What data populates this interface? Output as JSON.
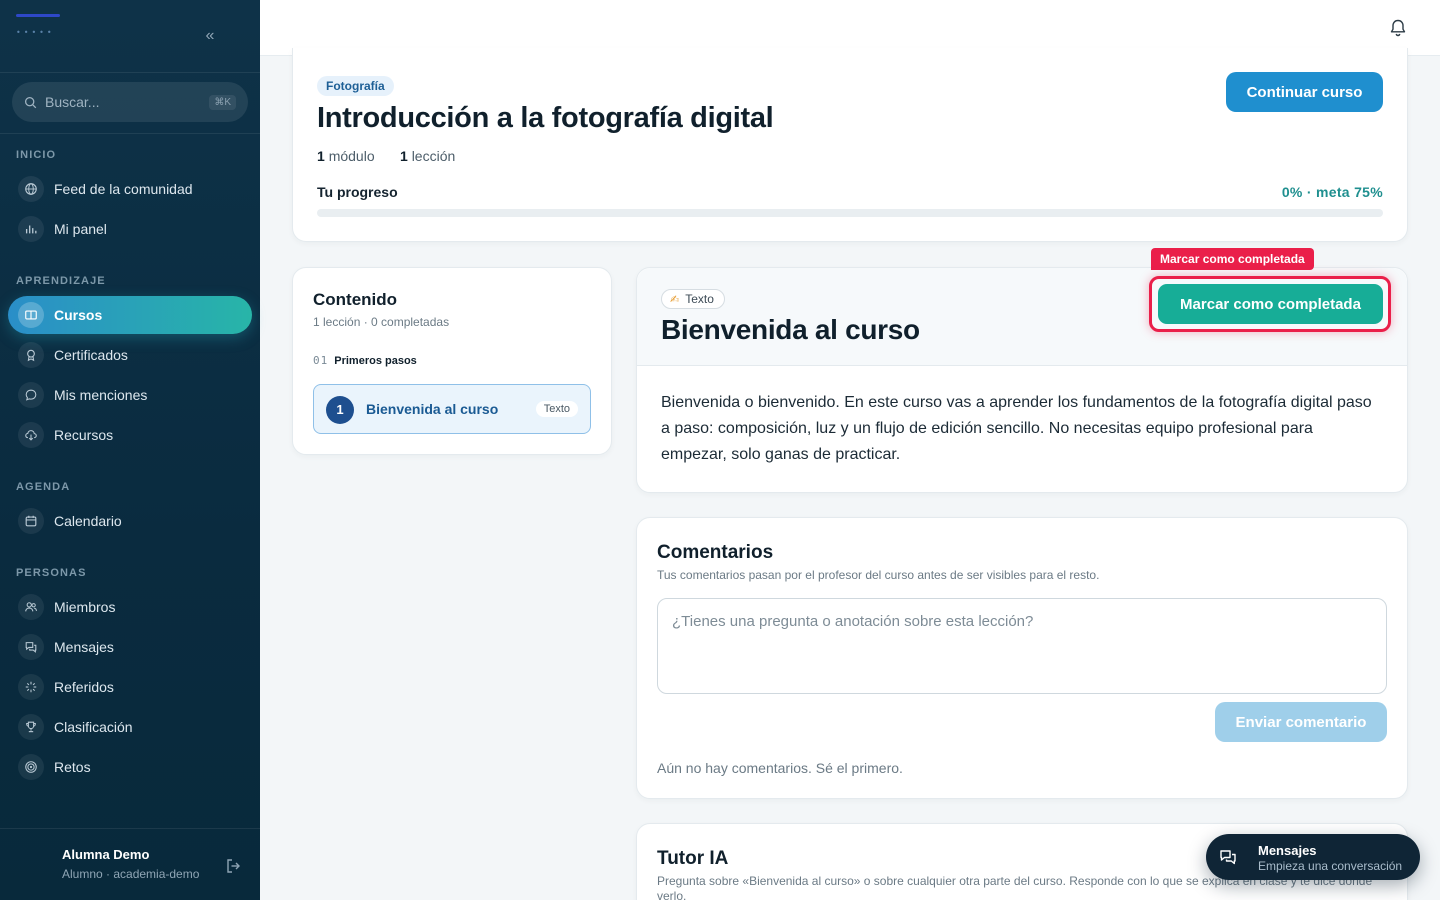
{
  "sidebar": {
    "search": {
      "placeholder": "Buscar...",
      "shortcut": "⌘K"
    },
    "sections": {
      "inicio": "INICIO",
      "aprendizaje": "APRENDIZAJE",
      "agenda": "AGENDA",
      "personas": "PERSONAS"
    },
    "items": {
      "feed": "Feed de la comunidad",
      "panel": "Mi panel",
      "cursos": "Cursos",
      "certificados": "Certificados",
      "menciones": "Mis menciones",
      "recursos": "Recursos",
      "calendario": "Calendario",
      "miembros": "Miembros",
      "mensajes": "Mensajes",
      "referidos": "Referidos",
      "clasificacion": "Clasificación",
      "retos": "Retos"
    },
    "active_item": "cursos",
    "user": {
      "name": "Alumna Demo",
      "role": "Alumno · academia-demo"
    }
  },
  "course": {
    "tag": "Fotografía",
    "title": "Introducción a la fotografía digital",
    "modules_count": "1",
    "modules_label": "módulo",
    "lessons_count": "1",
    "lessons_label": "lección",
    "continue_label": "Continuar curso",
    "progress_label": "Tu progreso",
    "progress_text": "0% · meta 75%",
    "progress_fraction": 0
  },
  "content_panel": {
    "title": "Contenido",
    "subtitle": "1 lección · 0 completadas",
    "module_number": "01",
    "module_name": "Primeros pasos",
    "lesson": {
      "number": "1",
      "name": "Bienvenida al curso",
      "type": "Texto"
    }
  },
  "lesson": {
    "type_label": "Texto",
    "title": "Bienvenida al curso",
    "complete_label": "Marcar como completada",
    "highlight_tag": "Marcar como completada",
    "body": "Bienvenida o bienvenido. En este curso vas a aprender los fundamentos de la fotografía digital paso a paso: composición, luz y un flujo de edición sencillo. No necesitas equipo profesional para empezar, solo ganas de practicar."
  },
  "comments": {
    "title": "Comentarios",
    "subtitle": "Tus comentarios pasan por el profesor del curso antes de ser visibles para el resto.",
    "placeholder": "¿Tienes una pregunta o anotación sobre esta lección?",
    "send_label": "Enviar comentario",
    "empty_text": "Aún no hay comentarios. Sé el primero."
  },
  "tutor": {
    "title": "Tutor IA",
    "subtitle": "Pregunta sobre «Bienvenida al curso» o sobre cualquier otra parte del curso. Responde con lo que se explica en clase y te dice dónde verlo."
  },
  "messages_fab": {
    "title": "Mensajes",
    "subtitle": "Empieza una conversación"
  },
  "colors": {
    "accent": "#1f8fcf",
    "complete": "#17ad97",
    "highlight": "#ea1f4a",
    "sidebar": "#0e3248"
  }
}
